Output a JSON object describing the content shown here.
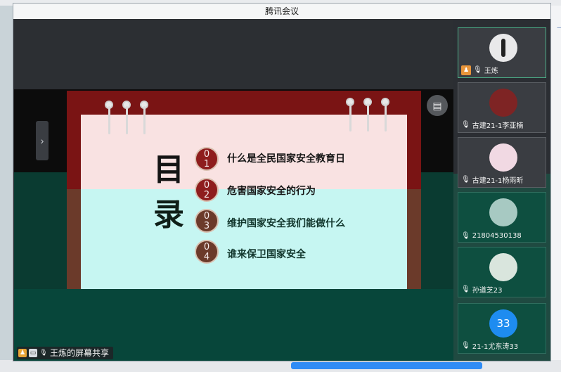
{
  "window": {
    "title": "腾讯会议"
  },
  "slide": {
    "title_chars": [
      "目",
      "录"
    ],
    "items": [
      {
        "num_top": "0",
        "num_bottom": "1",
        "text": "什么是全民国家安全教育日"
      },
      {
        "num_top": "0",
        "num_bottom": "2",
        "text": "危害国家安全的行为"
      },
      {
        "num_top": "0",
        "num_bottom": "3",
        "text": "维护国家安全我们能做什么"
      },
      {
        "num_top": "0",
        "num_bottom": "4",
        "text": "谁来保卫国家安全"
      }
    ]
  },
  "controls": {
    "next_arrow": "›",
    "layout_icon": "▤"
  },
  "share_label": {
    "text": "王炼的屏幕共享"
  },
  "participants": [
    {
      "name": "王炼",
      "avatar": "silhouette-icon",
      "host": true
    },
    {
      "name": "古建21-1李亚楠",
      "avatar": "photo-avatar"
    },
    {
      "name": "古建21-1杨雨昕",
      "avatar": "photo-avatar"
    },
    {
      "name": "21804530138",
      "avatar": "photo-avatar"
    },
    {
      "name": "孙道芝23",
      "avatar": "photo-avatar"
    },
    {
      "name": "21-1尤东涛33",
      "avatar_text": "33"
    }
  ],
  "colors": {
    "slide_red": "#7a1414",
    "panel_green": "#1f4a41",
    "badge_red": "#8e1d1d",
    "accent_blue": "#1e8cf0"
  }
}
